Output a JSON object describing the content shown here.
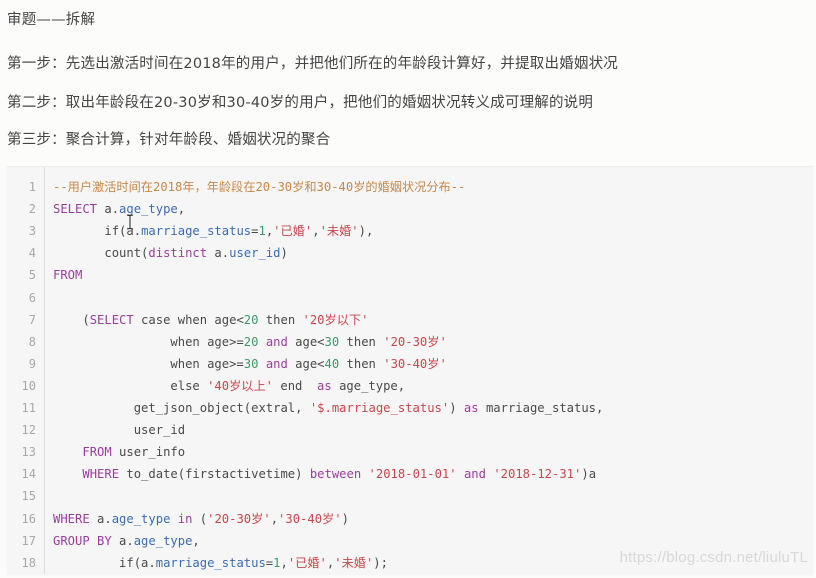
{
  "heading": "审题——拆解",
  "steps": [
    "第一步：先选出激活时间在2018年的用户，并把他们所在的年龄段计算好，并提取出婚姻状况",
    "第二步：取出年龄段在20-30岁和30-40岁的用户，把他们的婚姻状况转义成可理解的说明",
    "第三步：聚合计算，针对年龄段、婚姻状况的聚合"
  ],
  "code": {
    "language": "sql",
    "colors": {
      "comment": "#c8874a",
      "keyword": "#9a3e9e",
      "identifier": "#3b6cb3",
      "string": "#c8464c",
      "number": "#3d9a6a",
      "plain": "#4a4a4a"
    },
    "lines": [
      {
        "n": "1",
        "tokens": [
          [
            "cm",
            "--用户激活时间在2018年，年龄段在20-30岁和30-40岁的婚姻状况分布--"
          ]
        ]
      },
      {
        "n": "2",
        "tokens": [
          [
            "kw",
            "SELECT"
          ],
          [
            "pl",
            " a."
          ],
          [
            "id",
            "age_type"
          ],
          [
            "pl",
            ","
          ]
        ]
      },
      {
        "n": "3",
        "tokens": [
          [
            "pl",
            "       if(a."
          ],
          [
            "id",
            "marriage_status"
          ],
          [
            "pl",
            "="
          ],
          [
            "num",
            "1"
          ],
          [
            "pl",
            ","
          ],
          [
            "str",
            "'已婚'"
          ],
          [
            "pl",
            ","
          ],
          [
            "str",
            "'未婚'"
          ],
          [
            "pl",
            "),"
          ]
        ]
      },
      {
        "n": "4",
        "tokens": [
          [
            "pl",
            "       count("
          ],
          [
            "kw",
            "distinct"
          ],
          [
            "pl",
            " a."
          ],
          [
            "id",
            "user_id"
          ],
          [
            "pl",
            ")"
          ]
        ]
      },
      {
        "n": "5",
        "tokens": [
          [
            "kw",
            "FROM"
          ]
        ]
      },
      {
        "n": "6",
        "tokens": []
      },
      {
        "n": "7",
        "tokens": [
          [
            "pl",
            "    ("
          ],
          [
            "kw",
            "SELECT"
          ],
          [
            "pl",
            " case when age<"
          ],
          [
            "num",
            "20"
          ],
          [
            "pl",
            " then "
          ],
          [
            "str",
            "'20岁以下'"
          ]
        ]
      },
      {
        "n": "8",
        "tokens": [
          [
            "pl",
            "                when age>="
          ],
          [
            "num",
            "20"
          ],
          [
            "pl",
            " "
          ],
          [
            "kw",
            "and"
          ],
          [
            "pl",
            " age<"
          ],
          [
            "num",
            "30"
          ],
          [
            "pl",
            " then "
          ],
          [
            "str",
            "'20-30岁'"
          ]
        ]
      },
      {
        "n": "9",
        "tokens": [
          [
            "pl",
            "                when age>="
          ],
          [
            "num",
            "30"
          ],
          [
            "pl",
            " "
          ],
          [
            "kw",
            "and"
          ],
          [
            "pl",
            " age<"
          ],
          [
            "num",
            "40"
          ],
          [
            "pl",
            " then "
          ],
          [
            "str",
            "'30-40岁'"
          ]
        ]
      },
      {
        "n": "10",
        "tokens": [
          [
            "pl",
            "                else "
          ],
          [
            "str",
            "'40岁以上'"
          ],
          [
            "pl",
            " end  "
          ],
          [
            "kw",
            "as"
          ],
          [
            "pl",
            " age_type,"
          ]
        ]
      },
      {
        "n": "11",
        "tokens": [
          [
            "pl",
            "           get_json_object(extral, "
          ],
          [
            "str",
            "'$.marriage_status'"
          ],
          [
            "pl",
            ") "
          ],
          [
            "kw",
            "as"
          ],
          [
            "pl",
            " marriage_status,"
          ]
        ]
      },
      {
        "n": "12",
        "tokens": [
          [
            "pl",
            "           user_id"
          ]
        ]
      },
      {
        "n": "13",
        "tokens": [
          [
            "pl",
            "    "
          ],
          [
            "kw",
            "FROM"
          ],
          [
            "pl",
            " user_info"
          ]
        ]
      },
      {
        "n": "14",
        "tokens": [
          [
            "pl",
            "    "
          ],
          [
            "kw",
            "WHERE"
          ],
          [
            "pl",
            " to_date(firstactivetime) "
          ],
          [
            "kw",
            "between"
          ],
          [
            "pl",
            " "
          ],
          [
            "str",
            "'2018-01-01'"
          ],
          [
            "pl",
            " "
          ],
          [
            "kw",
            "and"
          ],
          [
            "pl",
            " "
          ],
          [
            "str",
            "'2018-12-31'"
          ],
          [
            "pl",
            ")a"
          ]
        ]
      },
      {
        "n": "15",
        "tokens": []
      },
      {
        "n": "16",
        "tokens": [
          [
            "kw",
            "WHERE"
          ],
          [
            "pl",
            " a."
          ],
          [
            "id",
            "age_type"
          ],
          [
            "pl",
            " "
          ],
          [
            "kw",
            "in"
          ],
          [
            "pl",
            " ("
          ],
          [
            "str",
            "'20-30岁'"
          ],
          [
            "pl",
            ","
          ],
          [
            "str",
            "'30-40岁'"
          ],
          [
            "pl",
            ")"
          ]
        ]
      },
      {
        "n": "17",
        "tokens": [
          [
            "kw",
            "GROUP BY"
          ],
          [
            "pl",
            " a."
          ],
          [
            "id",
            "age_type"
          ],
          [
            "pl",
            ","
          ]
        ]
      },
      {
        "n": "18",
        "tokens": [
          [
            "pl",
            "         if(a."
          ],
          [
            "id",
            "marriage_status"
          ],
          [
            "pl",
            "="
          ],
          [
            "num",
            "1"
          ],
          [
            "pl",
            ","
          ],
          [
            "str",
            "'已婚'"
          ],
          [
            "pl",
            ","
          ],
          [
            "str",
            "'未婚'"
          ],
          [
            "pl",
            ");"
          ]
        ]
      }
    ]
  },
  "watermark": "https://blog.csdn.net/liuluTL"
}
